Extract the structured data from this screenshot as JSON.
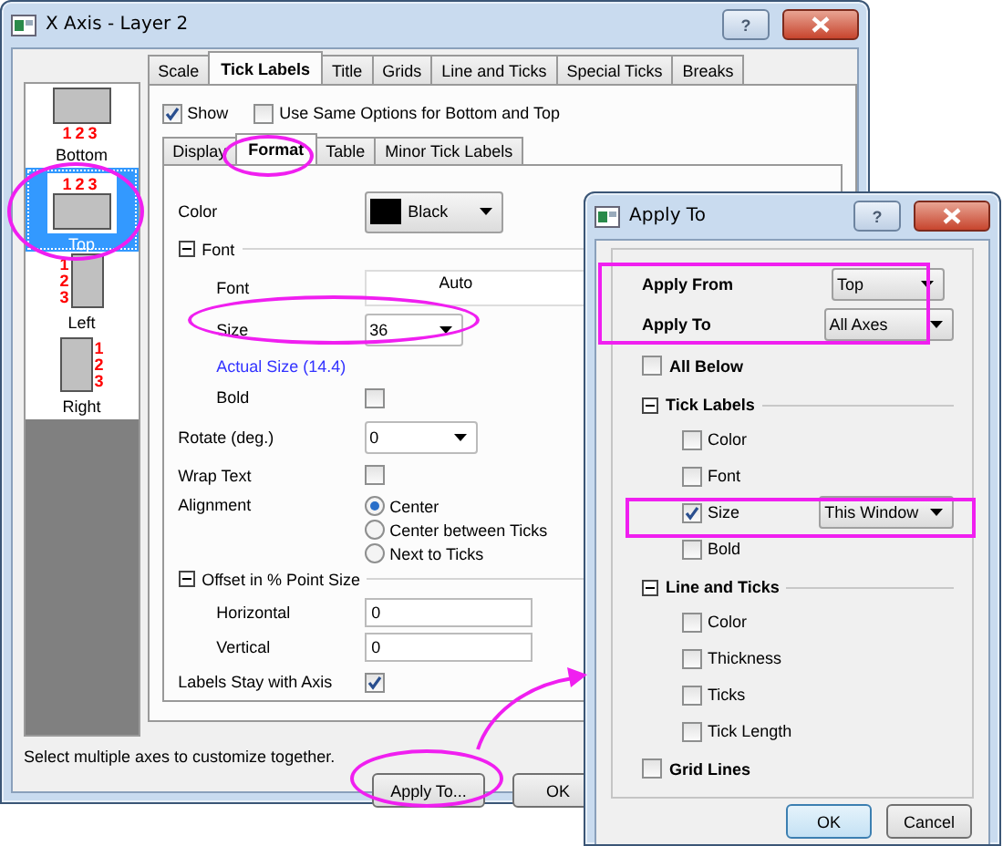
{
  "main_window": {
    "title": "X Axis - Layer 2",
    "help_button": "?",
    "axes": [
      {
        "label": "Bottom",
        "digits": "123",
        "kind": "bottom",
        "selected": false
      },
      {
        "label": "Top",
        "digits": "123",
        "kind": "top",
        "selected": true
      },
      {
        "label": "Left",
        "digits": "123",
        "kind": "left",
        "selected": false
      },
      {
        "label": "Right",
        "digits": "123",
        "kind": "right",
        "selected": false
      }
    ],
    "tabs": [
      {
        "label": "Scale",
        "selected": false
      },
      {
        "label": "Tick Labels",
        "selected": true
      },
      {
        "label": "Title",
        "selected": false
      },
      {
        "label": "Grids",
        "selected": false
      },
      {
        "label": "Line and Ticks",
        "selected": false
      },
      {
        "label": "Special Ticks",
        "selected": false
      },
      {
        "label": "Breaks",
        "selected": false
      }
    ],
    "show": {
      "label": "Show",
      "checked": true
    },
    "same_options": {
      "label": "Use Same Options for Bottom and Top",
      "checked": false
    },
    "subtabs": [
      {
        "label": "Display",
        "selected": false
      },
      {
        "label": "Format",
        "selected": true
      },
      {
        "label": "Table",
        "selected": false
      },
      {
        "label": "Minor Tick Labels",
        "selected": false
      }
    ],
    "rows": [
      {
        "kind": "color",
        "label": "Color",
        "value": "Black"
      },
      {
        "kind": "group",
        "label": "Font",
        "expanded": true,
        "children": [
          {
            "kind": "font_picker",
            "label": "Font",
            "value": "Auto"
          },
          {
            "kind": "combo",
            "label": "Size",
            "value": "36"
          },
          {
            "kind": "link",
            "label": "Actual Size (14.4)"
          },
          {
            "kind": "check",
            "label": "Bold",
            "checked": false
          }
        ]
      },
      {
        "kind": "combo",
        "label": "Rotate (deg.)",
        "value": "0"
      },
      {
        "kind": "check",
        "label": "Wrap Text",
        "checked": false
      },
      {
        "kind": "radio",
        "label": "Alignment",
        "options": [
          {
            "label": "Center",
            "selected": true
          },
          {
            "label": "Center between Ticks",
            "selected": false
          },
          {
            "label": "Next to Ticks",
            "selected": false
          }
        ]
      },
      {
        "kind": "group",
        "label": "Offset in % Point Size",
        "expanded": true,
        "children": [
          {
            "kind": "field",
            "label": "Horizontal",
            "value": "0"
          },
          {
            "kind": "field",
            "label": "Vertical",
            "value": "0"
          }
        ]
      },
      {
        "kind": "check",
        "label": "Labels Stay with Axis",
        "checked": true
      }
    ],
    "status": "Select multiple axes to customize together.",
    "buttons": [
      "Apply To...",
      "OK"
    ]
  },
  "apply_dialog": {
    "title": "Apply To",
    "help_button": "?",
    "apply_from": {
      "label": "Apply From",
      "value": "Top"
    },
    "apply_to": {
      "label": "Apply To",
      "value": "All Axes"
    },
    "options": [
      {
        "kind": "check",
        "label": "All Below",
        "checked": false
      },
      {
        "kind": "group",
        "label": "Tick Labels",
        "expanded": true,
        "children": [
          {
            "kind": "check",
            "label": "Color",
            "checked": false
          },
          {
            "kind": "check",
            "label": "Font",
            "checked": false
          },
          {
            "kind": "check",
            "label": "Size",
            "checked": true,
            "value": "This Window"
          },
          {
            "kind": "check",
            "label": "Bold",
            "checked": false
          }
        ]
      },
      {
        "kind": "group",
        "label": "Line and Ticks",
        "expanded": true,
        "children": [
          {
            "kind": "check",
            "label": "Color",
            "checked": false
          },
          {
            "kind": "check",
            "label": "Thickness",
            "checked": false
          },
          {
            "kind": "check",
            "label": "Ticks",
            "checked": false
          },
          {
            "kind": "check",
            "label": "Tick Length",
            "checked": false
          }
        ]
      },
      {
        "kind": "check",
        "label": "Grid Lines",
        "checked": false
      }
    ],
    "buttons": [
      {
        "label": "OK",
        "default": true
      },
      {
        "label": "Cancel",
        "default": false
      }
    ]
  }
}
